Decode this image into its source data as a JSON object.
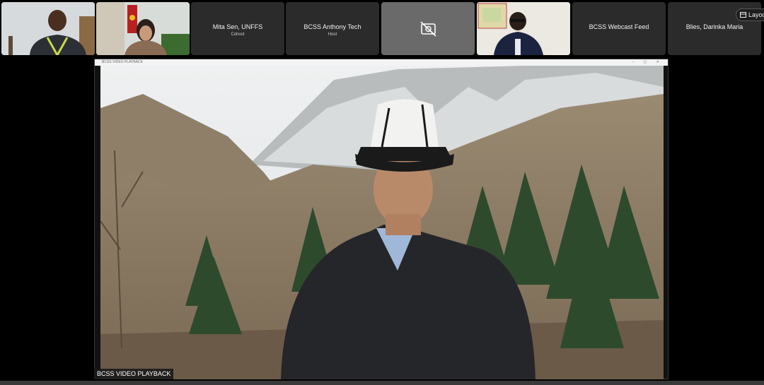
{
  "participants": [
    {
      "name": "",
      "role": "",
      "type": "video"
    },
    {
      "name": "",
      "role": "",
      "type": "video"
    },
    {
      "name": "Mita Sen, UNFFS",
      "role": "Cohost",
      "type": "name"
    },
    {
      "name": "BCSS Anthony Tech",
      "role": "Host",
      "type": "name"
    },
    {
      "name": "",
      "role": "",
      "type": "camera-off"
    },
    {
      "name": "",
      "role": "",
      "type": "video"
    },
    {
      "name": "BCSS Webcast Feed",
      "role": "",
      "type": "name"
    },
    {
      "name": "Blies, Darinka Maria",
      "role": "",
      "type": "name"
    }
  ],
  "layout_button": {
    "label": "Layou",
    "icon": "layout-icon"
  },
  "stage": {
    "window_title": "BCSS VIDEO PLAYBACK",
    "overlay_label": "BCSS VIDEO PLAYBACK"
  },
  "colors": {
    "tile_bg": "#2b2b2b",
    "background": "#000000"
  }
}
